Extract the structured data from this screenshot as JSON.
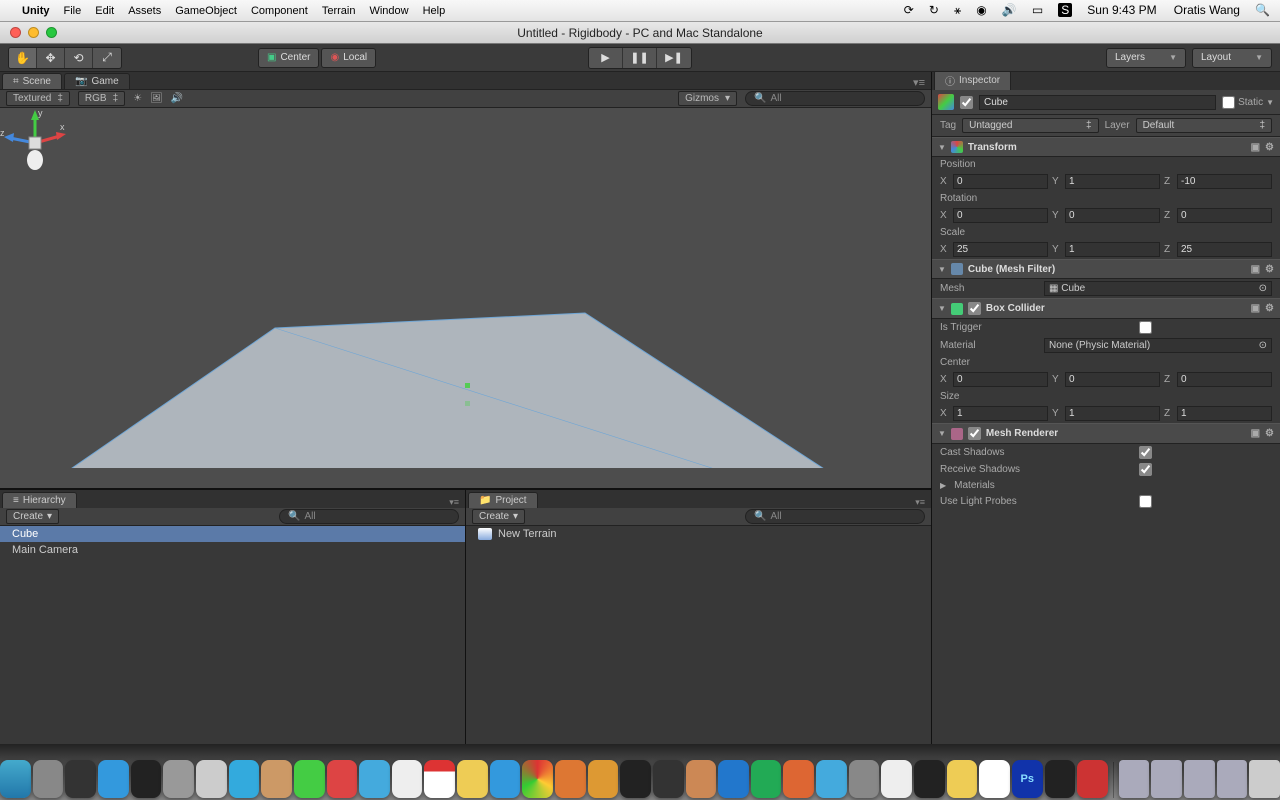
{
  "mac_menu": {
    "app": "Unity",
    "items": [
      "File",
      "Edit",
      "Assets",
      "GameObject",
      "Component",
      "Terrain",
      "Window",
      "Help"
    ],
    "time": "Sun 9:43 PM",
    "user": "Oratis Wang"
  },
  "window_title": "Untitled - Rigidbody - PC and Mac Standalone",
  "toolbar": {
    "pivot_center": "Center",
    "pivot_local": "Local",
    "layers": "Layers",
    "layout": "Layout"
  },
  "scene": {
    "tab_scene": "Scene",
    "tab_game": "Game",
    "shading": "Textured",
    "rendermode": "RGB",
    "gizmos": "Gizmos",
    "search_ph": "All",
    "gizmo_axes": {
      "x": "x",
      "y": "y",
      "z": "z"
    }
  },
  "hierarchy": {
    "title": "Hierarchy",
    "create": "Create",
    "search_ph": "All",
    "items": [
      "Cube",
      "Main Camera"
    ]
  },
  "project": {
    "title": "Project",
    "create": "Create",
    "search_ph": "All",
    "items": [
      "New Terrain"
    ]
  },
  "inspector": {
    "title": "Inspector",
    "obj_name": "Cube",
    "static": "Static",
    "tag_lbl": "Tag",
    "tag_val": "Untagged",
    "layer_lbl": "Layer",
    "layer_val": "Default",
    "transform": {
      "title": "Transform",
      "position": "Position",
      "rotation": "Rotation",
      "scale": "Scale",
      "pos": {
        "x": "0",
        "y": "1",
        "z": "-10"
      },
      "rot": {
        "x": "0",
        "y": "0",
        "z": "0"
      },
      "scl": {
        "x": "25",
        "y": "1",
        "z": "25"
      }
    },
    "meshfilter": {
      "title": "Cube (Mesh Filter)",
      "mesh_lbl": "Mesh",
      "mesh_val": "Cube"
    },
    "boxcollider": {
      "title": "Box Collider",
      "istrigger": "Is Trigger",
      "material": "Material",
      "material_val": "None (Physic Material)",
      "center": "Center",
      "size": "Size",
      "ctr": {
        "x": "0",
        "y": "0",
        "z": "0"
      },
      "sz": {
        "x": "1",
        "y": "1",
        "z": "1"
      }
    },
    "meshrenderer": {
      "title": "Mesh Renderer",
      "cast": "Cast Shadows",
      "receive": "Receive Shadows",
      "materials": "Materials",
      "probes": "Use Light Probes"
    }
  }
}
